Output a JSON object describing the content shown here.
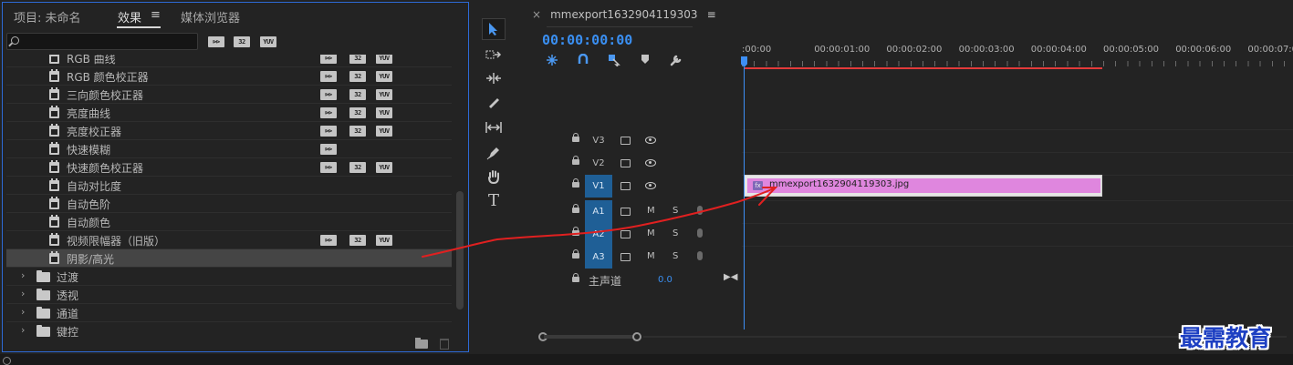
{
  "effects_panel": {
    "tabs": [
      {
        "label": "项目: 未命名"
      },
      {
        "label": "效果"
      },
      {
        "label": "媒体浏览器"
      }
    ],
    "tab_menu_glyph": "≡",
    "search": {
      "value": "",
      "placeholder": ""
    },
    "filter_badges": [
      "⊳⊳",
      "32",
      "YUV"
    ],
    "effects": [
      {
        "label": "RGB 曲线",
        "badges": [
          "⊳⊳",
          "32",
          "YUV"
        ]
      },
      {
        "label": "RGB 颜色校正器",
        "badges": [
          "⊳⊳",
          "32",
          "YUV"
        ]
      },
      {
        "label": "三向颜色校正器",
        "badges": [
          "⊳⊳",
          "32",
          "YUV"
        ]
      },
      {
        "label": "亮度曲线",
        "badges": [
          "⊳⊳",
          "32",
          "YUV"
        ]
      },
      {
        "label": "亮度校正器",
        "badges": [
          "⊳⊳",
          "32",
          "YUV"
        ]
      },
      {
        "label": "快速模糊",
        "badges": [
          "⊳⊳"
        ]
      },
      {
        "label": "快速颜色校正器",
        "badges": [
          "⊳⊳",
          "32",
          "YUV"
        ]
      },
      {
        "label": "自动对比度",
        "badges": []
      },
      {
        "label": "自动色阶",
        "badges": []
      },
      {
        "label": "自动颜色",
        "badges": []
      },
      {
        "label": "视频限幅器（旧版）",
        "badges": [
          "⊳⊳",
          "32",
          "YUV"
        ]
      },
      {
        "label": "阴影/高光",
        "badges": [],
        "selected": true
      }
    ],
    "folders": [
      {
        "label": "过渡"
      },
      {
        "label": "透视"
      },
      {
        "label": "通道"
      },
      {
        "label": "键控"
      }
    ]
  },
  "tools": [
    "selection-tool",
    "track-select-tool",
    "ripple-edit-tool",
    "razor-tool",
    "slip-tool",
    "pen-tool",
    "hand-tool",
    "type-tool"
  ],
  "timeline": {
    "sequence_name": "mmexport1632904119303",
    "close_glyph": "×",
    "menu_glyph": "≡",
    "timecode": "00:00:00:00",
    "ruler_labels": [
      ":00:00",
      "00:00:01:00",
      "00:00:02:00",
      "00:00:03:00",
      "00:00:04:00",
      "00:00:05:00",
      "00:00:06:00",
      "00:00:07:00"
    ],
    "video_tracks": [
      {
        "name": "V3",
        "targeted": false
      },
      {
        "name": "V2",
        "targeted": false
      },
      {
        "name": "V1",
        "targeted": true
      }
    ],
    "audio_tracks": [
      {
        "name": "A1",
        "m": "M",
        "s": "S"
      },
      {
        "name": "A2",
        "m": "M",
        "s": "S"
      },
      {
        "name": "A3",
        "m": "M",
        "s": "S"
      }
    ],
    "clip": {
      "name": "mmexport1632904119303.jpg",
      "fx": "fx"
    },
    "master": {
      "label": "主声道",
      "value": "0.0"
    }
  },
  "watermark": "最需教育",
  "colors": {
    "accent": "#2d6ad6",
    "timecode": "#3a8ff2",
    "work_area": "#e23a3a",
    "clip": "#df86de",
    "annotation": "#e02020"
  }
}
